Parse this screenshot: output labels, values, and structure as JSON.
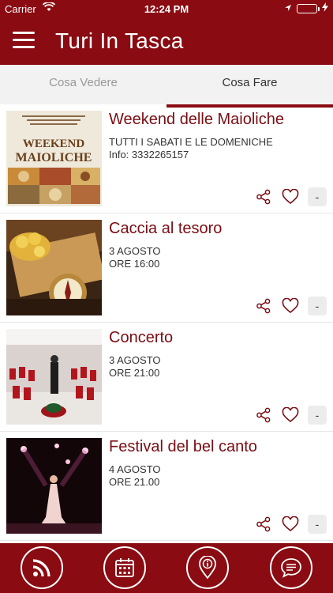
{
  "status_bar": {
    "carrier": "Carrier",
    "time": "12:24 PM"
  },
  "nav": {
    "title": "Turi In Tasca"
  },
  "tabs": [
    {
      "label": "Cosa Vedere",
      "active": false
    },
    {
      "label": "Cosa Fare",
      "active": true
    }
  ],
  "events": [
    {
      "title": "Weekend delle Maioliche",
      "line1": "TUTTI I SABATI E LE DOMENICHE",
      "line2": "Info: 3332265157",
      "thumb_text": "WEEKEND delle MAIOLICHE",
      "action_minus": "-"
    },
    {
      "title": "Caccia al tesoro",
      "line1": "3 AGOSTO",
      "line2": "ORE 16:00",
      "action_minus": "-"
    },
    {
      "title": "Concerto",
      "line1": "3 AGOSTO",
      "line2": "ORE 21:00",
      "action_minus": "-"
    },
    {
      "title": "Festival del bel canto",
      "line1": "4 AGOSTO",
      "line2": "ORE 21.00",
      "action_minus": "-"
    }
  ],
  "tabbar": [
    {
      "icon": "rss-icon"
    },
    {
      "icon": "calendar-icon"
    },
    {
      "icon": "map-pin-info-icon"
    },
    {
      "icon": "chat-icon"
    }
  ],
  "colors": {
    "brand": "#8a0b12",
    "title_text": "#7a0e14"
  }
}
